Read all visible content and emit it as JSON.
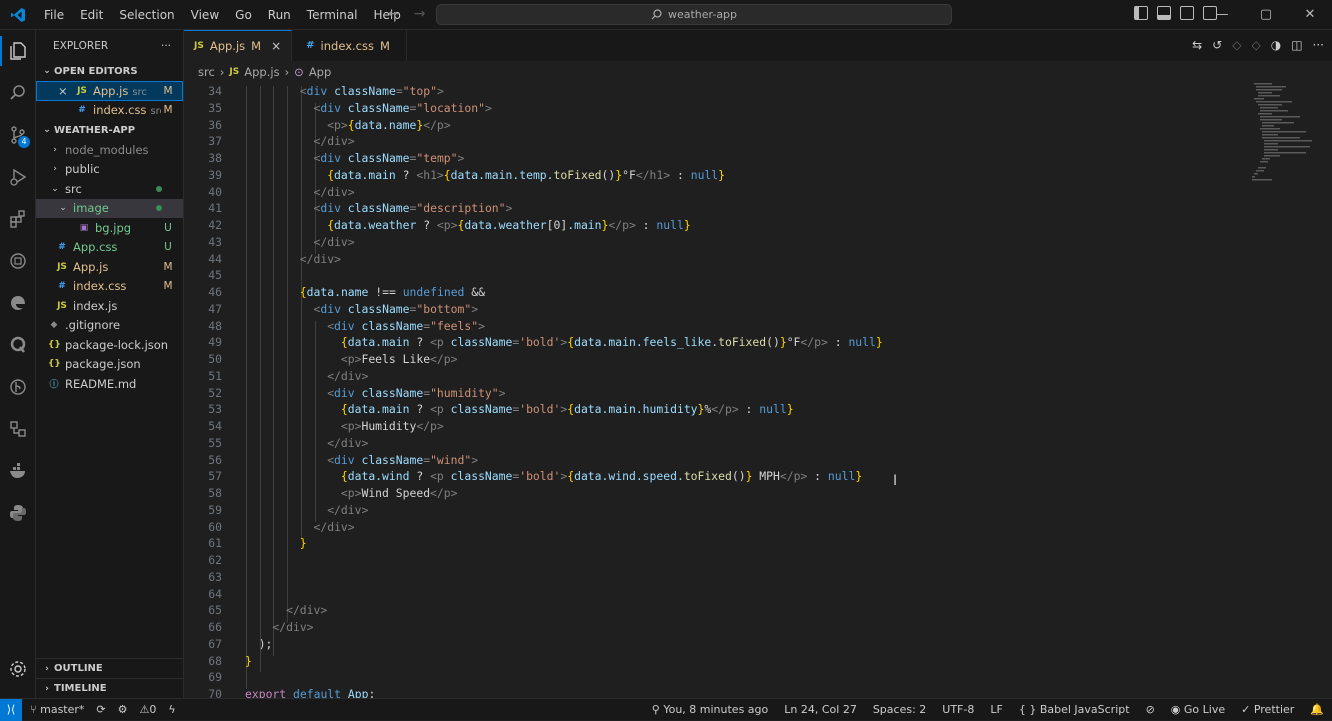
{
  "menu": [
    "File",
    "Edit",
    "Selection",
    "View",
    "Go",
    "Run",
    "Terminal",
    "Help"
  ],
  "command_center": "weather-app",
  "explorer": {
    "title": "EXPLORER",
    "more": "···",
    "open_editors_title": "OPEN EDITORS",
    "open_editors": [
      {
        "close": "×",
        "icon": "JS",
        "name": "App.js",
        "sub": "src",
        "status": "M"
      },
      {
        "icon": "#",
        "name": "index.css",
        "sub": "src",
        "status": "M"
      }
    ],
    "project_title": "WEATHER-APP",
    "tree": [
      {
        "chev": "›",
        "name": "node_modules"
      },
      {
        "chev": "›",
        "name": "public"
      },
      {
        "chev": "⌄",
        "name": "src"
      },
      {
        "chev": "⌄",
        "name": "image"
      },
      {
        "icon": "▣",
        "name": "bg.jpg",
        "status": "U"
      },
      {
        "icon": "#",
        "name": "App.css",
        "status": "U"
      },
      {
        "icon": "JS",
        "name": "App.js",
        "status": "M"
      },
      {
        "icon": "#",
        "name": "index.css",
        "status": "M"
      },
      {
        "icon": "JS",
        "name": "index.js"
      },
      {
        "icon": "◆",
        "name": ".gitignore"
      },
      {
        "icon": "{}",
        "name": "package-lock.json"
      },
      {
        "icon": "{}",
        "name": "package.json"
      },
      {
        "icon": "ⓘ",
        "name": "README.md"
      }
    ],
    "outline": "OUTLINE",
    "timeline": "TIMELINE"
  },
  "tabs": [
    {
      "icon": "JS",
      "name": "App.js",
      "status": "M",
      "close": "×"
    },
    {
      "icon": "#",
      "name": "index.css",
      "status": "M"
    }
  ],
  "breadcrumb": {
    "folder": "src",
    "file_icon": "JS",
    "file": "App.js",
    "symbol": "App",
    "sep": "›"
  },
  "line_numbers": [
    "34",
    "35",
    "36",
    "37",
    "38",
    "39",
    "40",
    "41",
    "42",
    "43",
    "44",
    "45",
    "46",
    "47",
    "48",
    "49",
    "50",
    "51",
    "52",
    "53",
    "54",
    "55",
    "56",
    "57",
    "58",
    "59",
    "60",
    "61",
    "62",
    "63",
    "64",
    "65",
    "66",
    "67",
    "68",
    "69",
    "70"
  ],
  "code": {
    "l34": [
      "<",
      "div",
      " className",
      "=",
      "\"top\"",
      ">"
    ],
    "l35": [
      "<",
      "div",
      " className",
      "=",
      "\"location\"",
      ">"
    ],
    "l36": [
      "<p>",
      "{",
      "data.name",
      "}",
      "</p>"
    ],
    "l37": [
      "</div>"
    ],
    "l38": [
      "<",
      "div",
      " className",
      "=",
      "\"temp\"",
      ">"
    ],
    "l39": [
      "{",
      "data.main",
      " ? ",
      "<h1>",
      "{",
      "data.main.temp.",
      "toFixed",
      "()",
      "}",
      "°F",
      "</h1>",
      " : ",
      "null",
      "}"
    ],
    "l40": [
      "</div>"
    ],
    "l41": [
      "<",
      "div",
      " className",
      "=",
      "\"description\"",
      ">"
    ],
    "l42": [
      "{",
      "data.weather",
      " ? ",
      "<p>",
      "{",
      "data.weather",
      "[0]",
      ".main",
      "}",
      "</p>",
      " : ",
      "null",
      "}"
    ],
    "l43": [
      "</div>"
    ],
    "l44": [
      "</div>"
    ],
    "l46": [
      "{",
      "data.name",
      " !== ",
      "undefined",
      " &&"
    ],
    "l47": [
      "<",
      "div",
      " className",
      "=",
      "\"bottom\"",
      ">"
    ],
    "l48": [
      "<",
      "div",
      " className",
      "=",
      "\"feels\"",
      ">"
    ],
    "l49": [
      "{",
      "data.main",
      " ? ",
      "<p",
      " className",
      "=",
      "'bold'",
      ">",
      "{",
      "data.main.feels_like.",
      "toFixed",
      "()",
      "}",
      "°F",
      "</p>",
      " : ",
      "null",
      "}"
    ],
    "l50": [
      "<p>",
      "Feels Like",
      "</p>"
    ],
    "l51": [
      "</div>"
    ],
    "l52": [
      "<",
      "div",
      " className",
      "=",
      "\"humidity\"",
      ">"
    ],
    "l53": [
      "{",
      "data.main",
      " ? ",
      "<p",
      " className",
      "=",
      "'bold'",
      ">",
      "{",
      "data.main.humidity",
      "}",
      "%",
      "</p>",
      " : ",
      "null",
      "}"
    ],
    "l54": [
      "<p>",
      "Humidity",
      "</p>"
    ],
    "l55": [
      "</div>"
    ],
    "l56": [
      "<",
      "div",
      " className",
      "=",
      "\"wind\"",
      ">"
    ],
    "l57": [
      "{",
      "data.wind",
      " ? ",
      "<p",
      " className",
      "=",
      "'bold'",
      ">",
      "{",
      "data.wind.speed.",
      "toFixed",
      "()",
      "}",
      " MPH",
      "</p>",
      " : ",
      "null",
      "}"
    ],
    "l58": [
      "<p>",
      "Wind Speed",
      "</p>"
    ],
    "l59": [
      "</div>"
    ],
    "l60": [
      "</div>"
    ],
    "l61": [
      "}"
    ],
    "l65": [
      "</div>"
    ],
    "l66": [
      "</div>"
    ],
    "l67": [
      ");"
    ],
    "l68": [
      "}"
    ],
    "l70": [
      "export",
      " default ",
      "App",
      ";"
    ]
  },
  "status": {
    "branch": "master*",
    "sync": "⟳",
    "problems": "0",
    "blame": "You, 8 minutes ago",
    "position": "Ln 24, Col 27",
    "spaces": "Spaces: 2",
    "encoding": "UTF-8",
    "eol": "LF",
    "language": "Babel JavaScript",
    "golive": "Go Live",
    "prettier": "Prettier"
  },
  "colors": {
    "accent": "#0078d4",
    "modified": "#e2c08d",
    "untracked": "#73c991",
    "bg": "#1f1f1f",
    "sidebar": "#181818"
  }
}
